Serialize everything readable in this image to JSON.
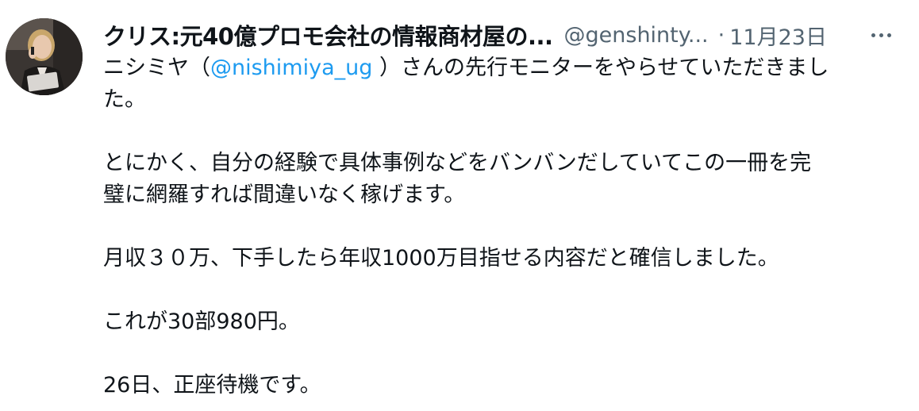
{
  "tweet": {
    "display_name": "クリス:元40億プロモ会社の情報商材屋の...",
    "handle": "@genshinty...",
    "separator": "·",
    "date": "11月23日",
    "more_icon": "more-horizontal-icon",
    "avatar_icon": "avatar-photo",
    "body": {
      "line1_prefix": "ニシミヤ（",
      "line1_mention": "@nishimiya_ug",
      "line1_suffix": " ）さんの先行モニターをやらせていただきまし",
      "line2": "た。",
      "line3": "とにかく、自分の経験で具体事例などをバンバンだしていてこの一冊を完",
      "line4": "璧に網羅すれば間違いなく稼げます。",
      "line5": "月収３０万、下手したら年収1000万目指せる内容だと確信しました。",
      "line6": "これが30部980円。",
      "line7": "26日、正座待機です。"
    }
  },
  "colors": {
    "text": "#0f1419",
    "secondary": "#536471",
    "link": "#1d9bf0",
    "background": "#ffffff"
  }
}
